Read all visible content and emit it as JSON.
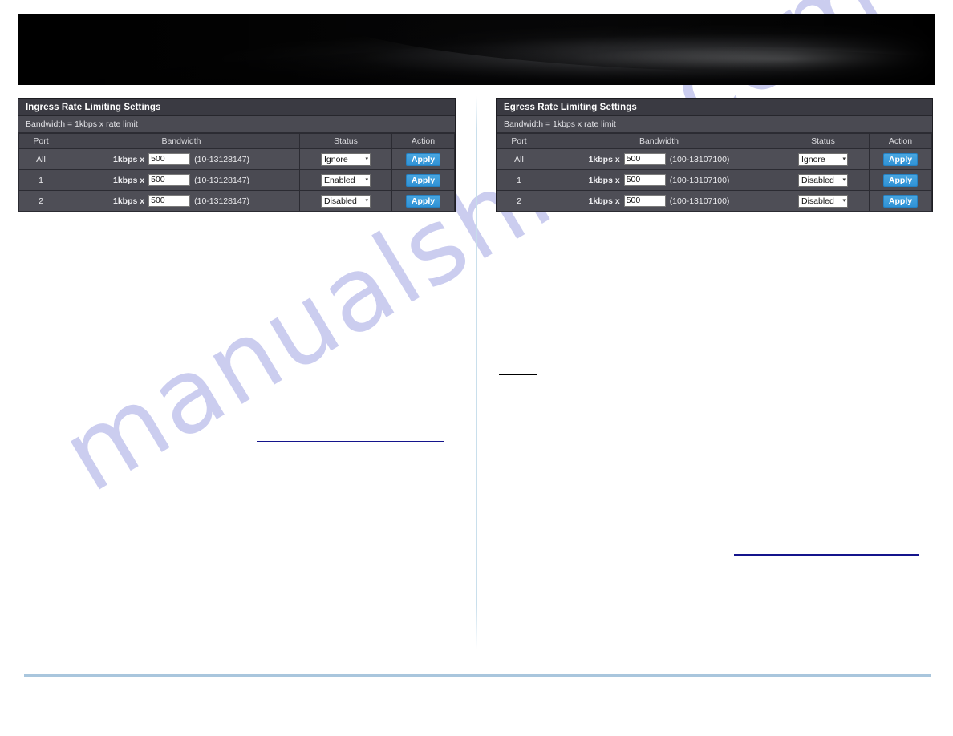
{
  "watermark": {
    "text": "manualshive.com"
  },
  "banner": {
    "alt": "product-banner-graphic"
  },
  "panels": [
    {
      "key": "ingress",
      "title": "Ingress Rate Limiting Settings",
      "note": "Bandwidth = 1kbps x rate limit",
      "columns": [
        "Port",
        "Bandwidth",
        "Status",
        "Action"
      ],
      "rows": [
        {
          "port": "All",
          "bw_prefix": "1kbps x",
          "bw_value": "500",
          "bw_range": "(10-13128147)",
          "status": "Ignore",
          "action": "Apply"
        },
        {
          "port": "1",
          "bw_prefix": "1kbps x",
          "bw_value": "500",
          "bw_range": "(10-13128147)",
          "status": "Enabled",
          "action": "Apply"
        },
        {
          "port": "2",
          "bw_prefix": "1kbps x",
          "bw_value": "500",
          "bw_range": "(10-13128147)",
          "status": "Disabled",
          "action": "Apply"
        }
      ]
    },
    {
      "key": "egress",
      "title": "Egress Rate Limiting Settings",
      "note": "Bandwidth = 1kbps x rate limit",
      "columns": [
        "Port",
        "Bandwidth",
        "Status",
        "Action"
      ],
      "rows": [
        {
          "port": "All",
          "bw_prefix": "1kbps x",
          "bw_value": "500",
          "bw_range": "(100-13107100)",
          "status": "Ignore",
          "action": "Apply"
        },
        {
          "port": "1",
          "bw_prefix": "1kbps x",
          "bw_value": "500",
          "bw_range": "(100-13107100)",
          "status": "Disabled",
          "action": "Apply"
        },
        {
          "port": "2",
          "bw_prefix": "1kbps x",
          "bw_value": "500",
          "bw_range": "(100-13107100)",
          "status": "Disabled",
          "action": "Apply"
        }
      ]
    }
  ],
  "colors": {
    "panel_title_bg": "#3a3a42",
    "panel_bg": "#4a4a52",
    "row_bg": "#4e4e56",
    "apply_button": "#2f92d6",
    "footer_rule": "#a9c6dd",
    "navy_rule": "#14148c",
    "watermark": "#c9cbef"
  },
  "icons": {
    "caret_down": "▾"
  }
}
